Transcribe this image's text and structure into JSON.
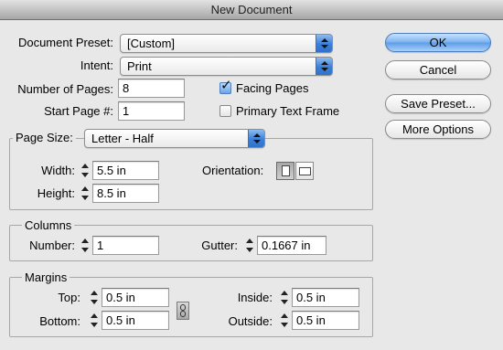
{
  "window": {
    "title": "New Document"
  },
  "document_preset": {
    "label": "Document Preset:",
    "value": "[Custom]"
  },
  "intent": {
    "label": "Intent:",
    "value": "Print"
  },
  "number_of_pages": {
    "label": "Number of Pages:",
    "value": "8"
  },
  "start_page": {
    "label": "Start Page #:",
    "value": "1"
  },
  "facing_pages": {
    "label": "Facing Pages",
    "checked": true
  },
  "primary_text_frame": {
    "label": "Primary Text Frame",
    "checked": false
  },
  "page_size": {
    "label": "Page Size:",
    "value": "Letter - Half",
    "width_label": "Width:",
    "width": "5.5 in",
    "height_label": "Height:",
    "height": "8.5 in",
    "orientation_label": "Orientation:",
    "orientation": "portrait",
    "portrait_icon": "portrait-icon",
    "landscape_icon": "landscape-icon"
  },
  "columns": {
    "title": "Columns",
    "number_label": "Number:",
    "number": "1",
    "gutter_label": "Gutter:",
    "gutter": "0.1667 in"
  },
  "margins": {
    "title": "Margins",
    "top_label": "Top:",
    "top": "0.5 in",
    "bottom_label": "Bottom:",
    "bottom": "0.5 in",
    "inside_label": "Inside:",
    "inside": "0.5 in",
    "outside_label": "Outside:",
    "outside": "0.5 in",
    "link_icon": "chain-link-icon"
  },
  "buttons": {
    "ok": "OK",
    "cancel": "Cancel",
    "save_preset": "Save Preset...",
    "more_options": "More Options"
  },
  "colors": {
    "accent": "#5c9ce8",
    "background": "#e8e8e8"
  }
}
